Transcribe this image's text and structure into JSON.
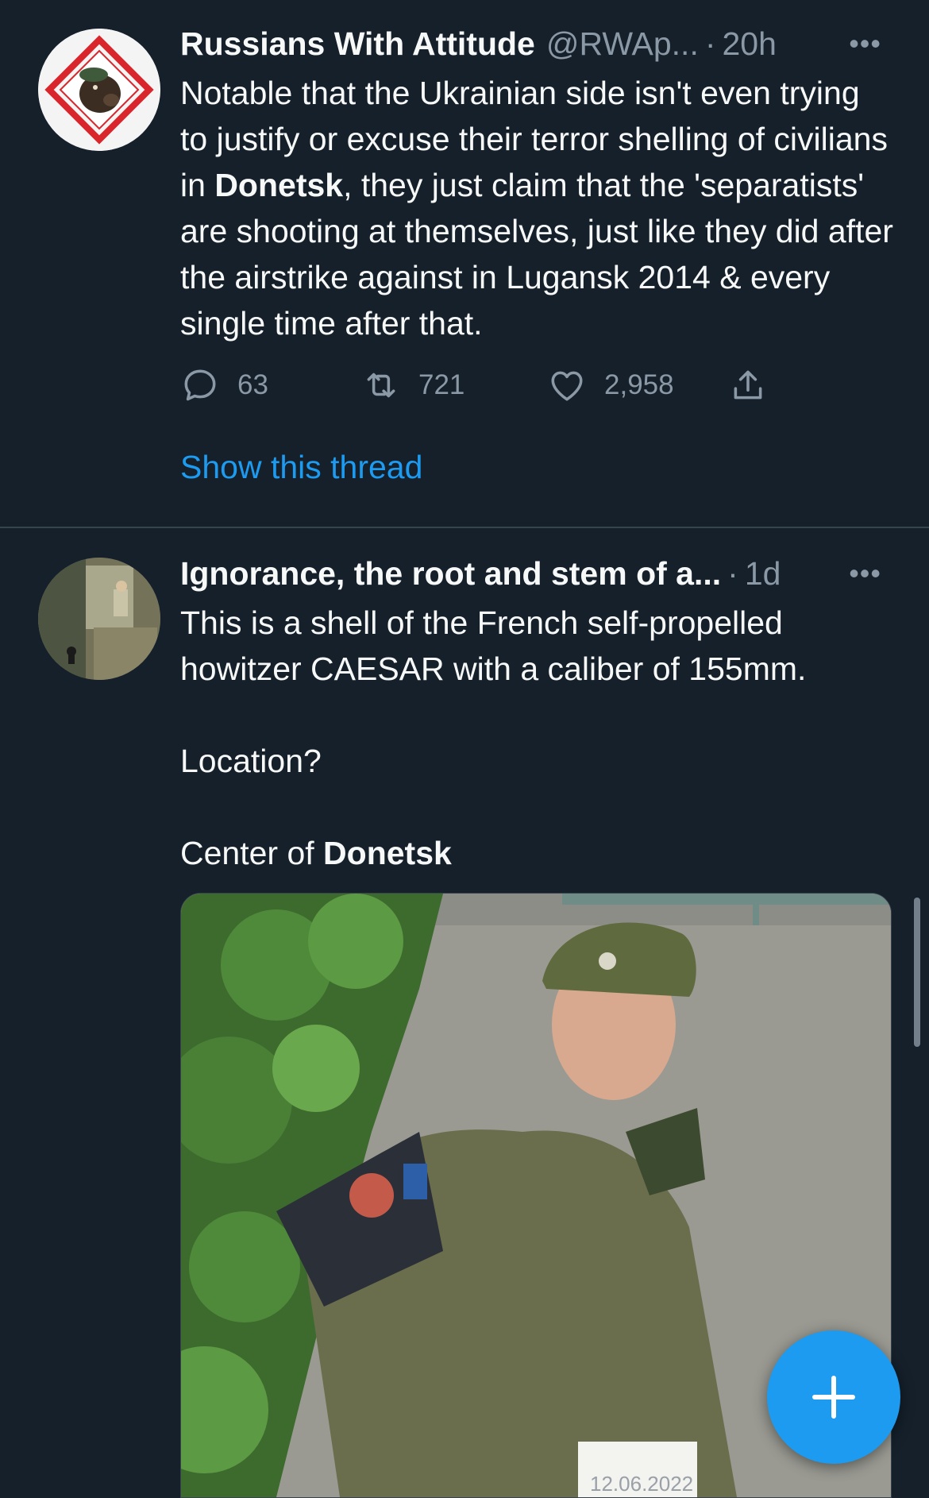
{
  "colors": {
    "background": "#15202b",
    "accent": "#1d9bf0",
    "secondary_text": "#8b98a5",
    "divider": "#38444d"
  },
  "tweets": [
    {
      "name": "Russians With Attitude",
      "handle": "@RWAp...",
      "separator": "·",
      "time": "20h",
      "more": "•••",
      "text_before": "Notable that the Ukrainian side isn't even trying to justify or excuse their terror shelling of civilians in ",
      "text_bold": "Donetsk",
      "text_after": ", they just claim that the 'separatists' are shooting at themselves, just like they did after the airstrike against in Lugansk 2014 & every single time after that.",
      "reply_count": "63",
      "retweet_count": "721",
      "like_count": "2,958",
      "show_thread": "Show this thread",
      "icons": [
        "reply-icon",
        "retweet-icon",
        "like-icon",
        "share-icon",
        "more-icon"
      ]
    },
    {
      "name": "Ignorance, the root and stem of a...",
      "separator": "·",
      "time": "1d",
      "more": "•••",
      "line1": "This is a shell of the French self-propelled howitzer CAESAR with a caliber of 155mm.",
      "line2": "Location?",
      "line3_before": "Center of ",
      "line3_bold": "Donetsk",
      "media_date": "12.06.2022",
      "icons": [
        "more-icon"
      ]
    }
  ],
  "fab": {
    "icon": "plus-icon"
  }
}
